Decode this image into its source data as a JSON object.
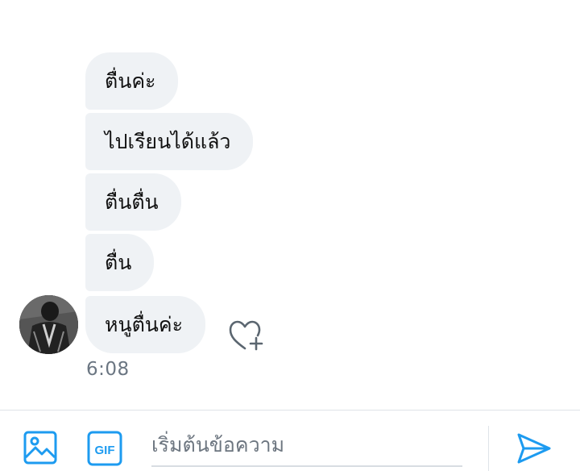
{
  "messages": [
    {
      "text": "ตื่นค่ะ"
    },
    {
      "text": "ไปเรียนได้แล้ว"
    },
    {
      "text": "ตื่นตื่น"
    },
    {
      "text": "ตื่น"
    },
    {
      "text": "หนูตื่นค่ะ"
    }
  ],
  "timestamp": "6:08",
  "composer": {
    "placeholder": "เริ่มต้นข้อความ",
    "gif_label": "GIF"
  },
  "colors": {
    "accent": "#1d9bf0",
    "bubble_bg": "#eff2f5",
    "muted_text": "#6b7682"
  },
  "icons": {
    "image": "image-icon",
    "gif": "gif-icon",
    "send": "send-icon",
    "react": "heart-plus-icon"
  }
}
